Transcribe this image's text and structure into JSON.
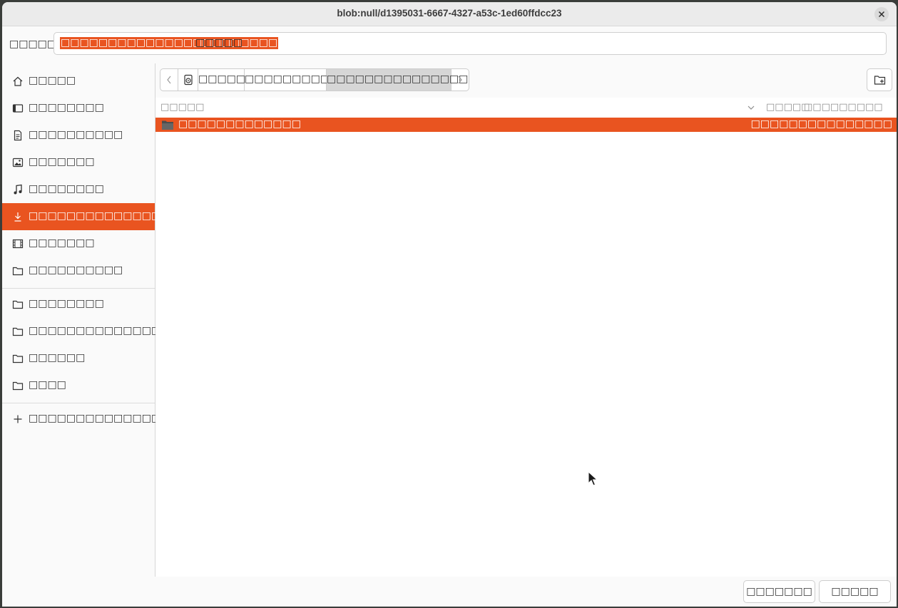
{
  "window": {
    "title": "blob:null/d1395031-6667-4327-a53c-1ed60ffdcc23"
  },
  "name_field": {
    "label": "□□□□□",
    "selected_text": "□□□□□□□□□□□□□□□□□□□□□□□",
    "rest_text": "□□□□□"
  },
  "sidebar": {
    "places": [
      {
        "icon": "home-icon",
        "label": "□□□□□"
      },
      {
        "icon": "desktop-icon",
        "label": "□□□□□□□□"
      },
      {
        "icon": "documents-icon",
        "label": "□□□□□□□□□□"
      },
      {
        "icon": "pictures-icon",
        "label": "□□□□□□□"
      },
      {
        "icon": "music-icon",
        "label": "□□□□□□□□"
      },
      {
        "icon": "downloads-icon",
        "label": "□□□□□□□□□□□□□□□□□□"
      },
      {
        "icon": "videos-icon",
        "label": "□□□□□□□"
      },
      {
        "icon": "folder-icon",
        "label": "□□□□□□□□□□"
      }
    ],
    "bookmarks": [
      {
        "icon": "folder-icon",
        "label": "□□□□□□□□"
      },
      {
        "icon": "folder-icon",
        "label": "□□□□□□□□□□□□□□"
      },
      {
        "icon": "folder-icon",
        "label": "□□□□□□"
      },
      {
        "icon": "folder-icon",
        "label": "□□□□"
      }
    ],
    "other": {
      "icon": "plus-icon",
      "label": "□□□□□□□□□□□□□□□□□□"
    },
    "active_index": 5
  },
  "pathbar": {
    "segments": [
      "□□□□□",
      "□□□□□□□□□□",
      "□□□□□□□□□□□□□□□□□□"
    ]
  },
  "columns": {
    "name": "□□□□□",
    "size": "□□□□□",
    "modified": "□□□□□□□□□"
  },
  "files": [
    {
      "name": "□□□□□□□□□□□□□",
      "modified": "□□□□□□□□□□□□□□□"
    }
  ],
  "footer": {
    "cancel_label": "□□□□□□□",
    "save_label": "□□□□□"
  },
  "colors": {
    "accent": "#e95420"
  }
}
